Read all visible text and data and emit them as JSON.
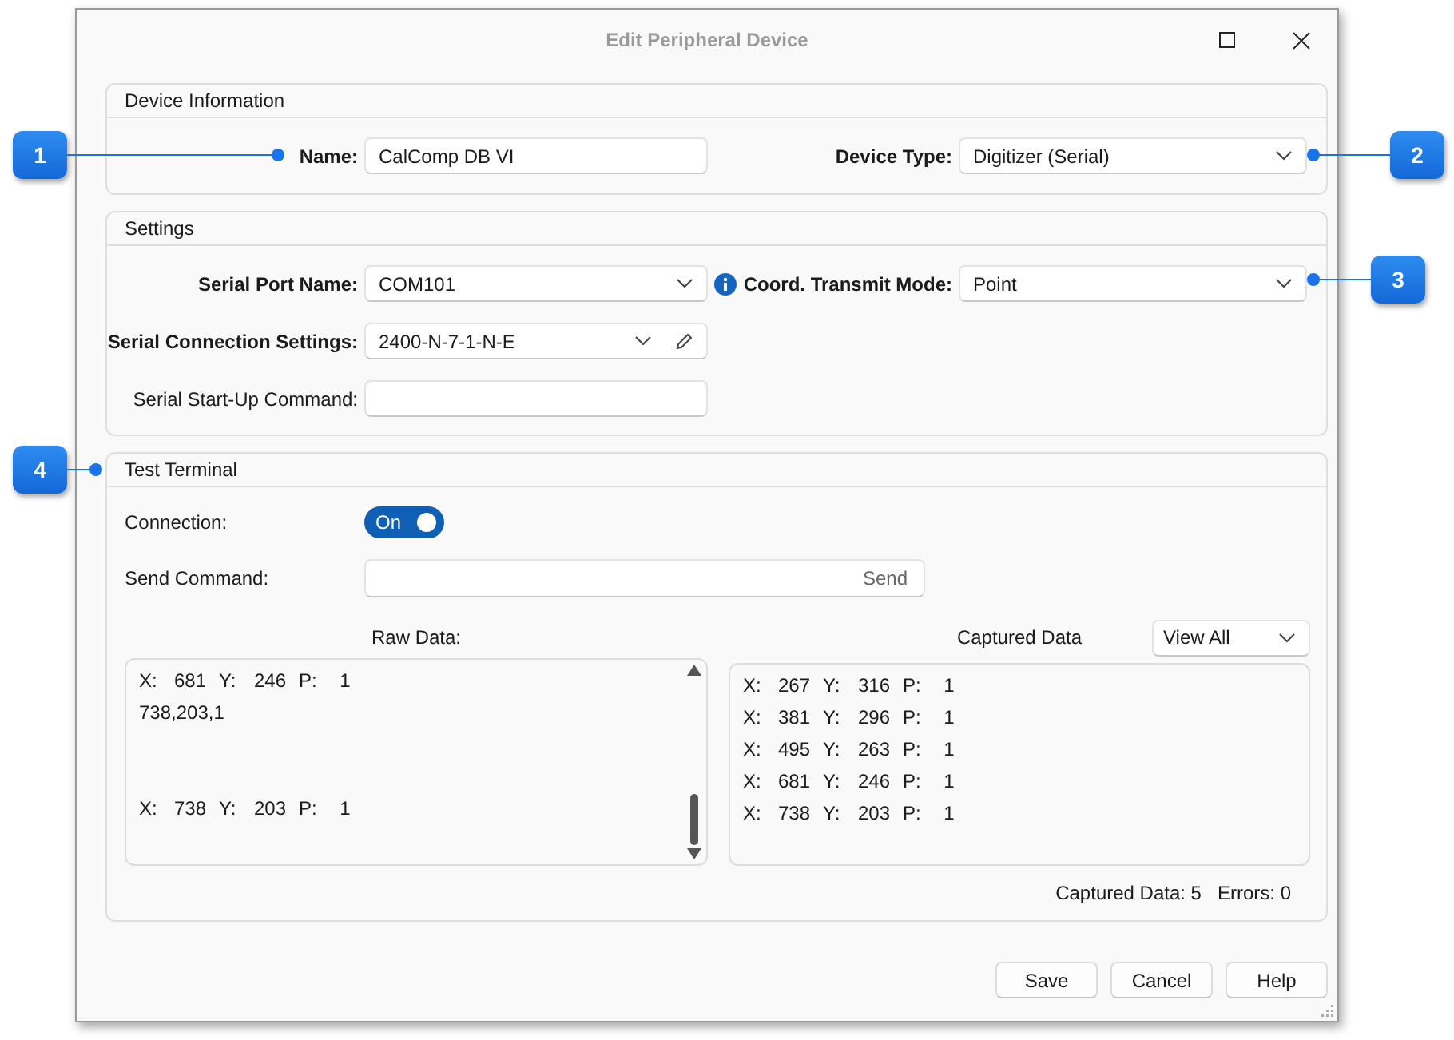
{
  "window": {
    "title": "Edit Peripheral Device"
  },
  "device_information": {
    "title": "Device Information",
    "name_label": "Name:",
    "name_value": "CalComp DB VI",
    "device_type_label": "Device Type:",
    "device_type_value": "Digitizer (Serial)"
  },
  "settings": {
    "title": "Settings",
    "serial_port_label": "Serial Port Name:",
    "serial_port_value": "COM101",
    "transmit_mode_label": "Coord. Transmit Mode:",
    "transmit_mode_value": "Point",
    "connection_settings_label": "Serial Connection Settings:",
    "connection_settings_value": "2400-N-7-1-N-E",
    "startup_command_label": "Serial Start-Up Command:"
  },
  "test_terminal": {
    "title": "Test Terminal",
    "connection_label": "Connection:",
    "connection_toggle": {
      "label": "On",
      "on": true
    },
    "send_command_label": "Send Command:",
    "send_button": "Send",
    "raw_data_label": "Raw Data:",
    "captured_data_label": "Captured Data",
    "view_filter": "View All",
    "raw_data": [
      {
        "kind": "point",
        "cells": [
          "X:",
          "681",
          "Y:",
          "246",
          "P:",
          "1"
        ]
      },
      {
        "kind": "text",
        "text": "738,203,1"
      },
      {
        "kind": "blank"
      },
      {
        "kind": "blank"
      },
      {
        "kind": "point",
        "cells": [
          "X:",
          "738",
          "Y:",
          "203",
          "P:",
          "1"
        ]
      }
    ],
    "captured_data": [
      {
        "cells": [
          "X:",
          "267",
          "Y:",
          "316",
          "P:",
          "1"
        ]
      },
      {
        "cells": [
          "X:",
          "381",
          "Y:",
          "296",
          "P:",
          "1"
        ]
      },
      {
        "cells": [
          "X:",
          "495",
          "Y:",
          "263",
          "P:",
          "1"
        ]
      },
      {
        "cells": [
          "X:",
          "681",
          "Y:",
          "246",
          "P:",
          "1"
        ]
      },
      {
        "cells": [
          "X:",
          "738",
          "Y:",
          "203",
          "P:",
          "1"
        ]
      }
    ],
    "captured_count": "Captured Data: 5",
    "errors": "Errors: 0"
  },
  "buttons": [
    "Save",
    "Cancel",
    "Help"
  ],
  "callouts": [
    {
      "number": "1"
    },
    {
      "number": "2"
    },
    {
      "number": "3"
    },
    {
      "number": "4"
    }
  ]
}
